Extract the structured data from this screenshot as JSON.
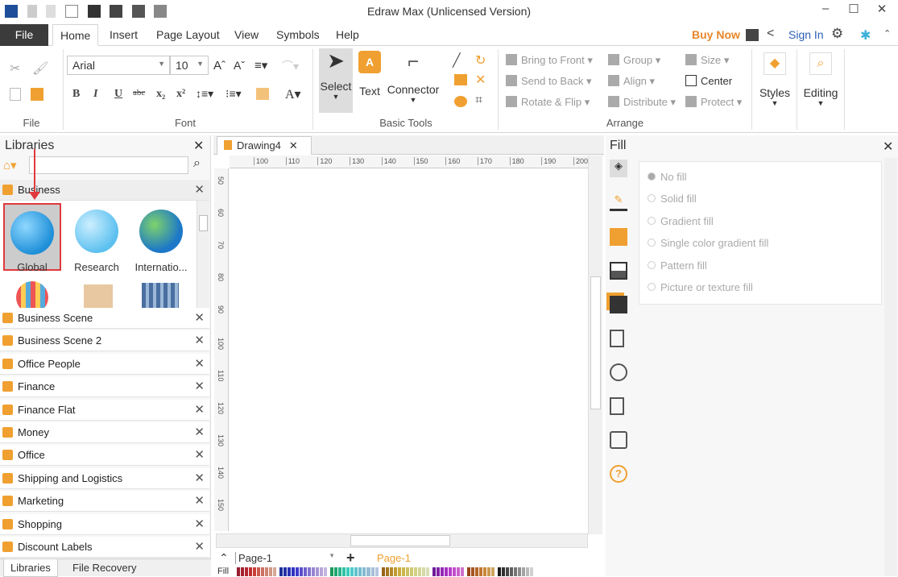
{
  "app": {
    "title": "Edraw Max (Unlicensed Version)"
  },
  "menu_tabs": [
    "File",
    "Home",
    "Insert",
    "Page Layout",
    "View",
    "Symbols",
    "Help"
  ],
  "account": {
    "buy_now": "Buy Now",
    "sign_in": "Sign In"
  },
  "ribbon": {
    "groups": {
      "file": "File",
      "font": "Font",
      "basic_tools": "Basic Tools",
      "arrange": "Arrange"
    },
    "font_name": "Arial",
    "font_size": "10",
    "format_buttons": [
      "B",
      "I",
      "U",
      "abc",
      "x₂",
      "x²"
    ],
    "tools": {
      "select": "Select",
      "text": "Text",
      "connector": "Connector"
    },
    "arrange": {
      "bring_to_front": "Bring to Front",
      "send_to_back": "Send to Back",
      "rotate_flip": "Rotate & Flip",
      "group": "Group",
      "align": "Align",
      "distribute": "Distribute",
      "size": "Size",
      "center": "Center",
      "protect": "Protect"
    },
    "styles": "Styles",
    "editing": "Editing"
  },
  "libraries": {
    "title": "Libraries",
    "search_value": "",
    "expanded": {
      "name": "Business",
      "shapes": [
        "Global",
        "Research",
        "Internatio..."
      ]
    },
    "items": [
      "Business Scene",
      "Business Scene 2",
      "Office People",
      "Finance",
      "Finance Flat",
      "Money",
      "Office",
      "Shipping and Logistics",
      "Marketing",
      "Shopping",
      "Discount Labels"
    ],
    "bottom_tabs": [
      "Libraries",
      "File Recovery"
    ]
  },
  "document": {
    "tab": "Drawing4",
    "h_ruler": [
      "100",
      "110",
      "120",
      "130",
      "140",
      "150",
      "160",
      "170",
      "180",
      "190",
      "200"
    ],
    "v_ruler": [
      "50",
      "60",
      "70",
      "80",
      "90",
      "100",
      "110",
      "120",
      "130",
      "140",
      "150"
    ]
  },
  "pages": {
    "selector": "Page-1",
    "active": "Page-1",
    "fill_label": "Fill"
  },
  "fill_panel": {
    "title": "Fill",
    "options": [
      "No fill",
      "Solid fill",
      "Gradient fill",
      "Single color gradient fill",
      "Pattern fill",
      "Picture or texture fill"
    ],
    "selected": "No fill"
  },
  "colors": {
    "accent": "#f0a030",
    "file_tab": "#3b3b3b",
    "buy_now": "#e8862a",
    "sign_in": "#2b5fb4",
    "highlight": "#e0393e"
  }
}
